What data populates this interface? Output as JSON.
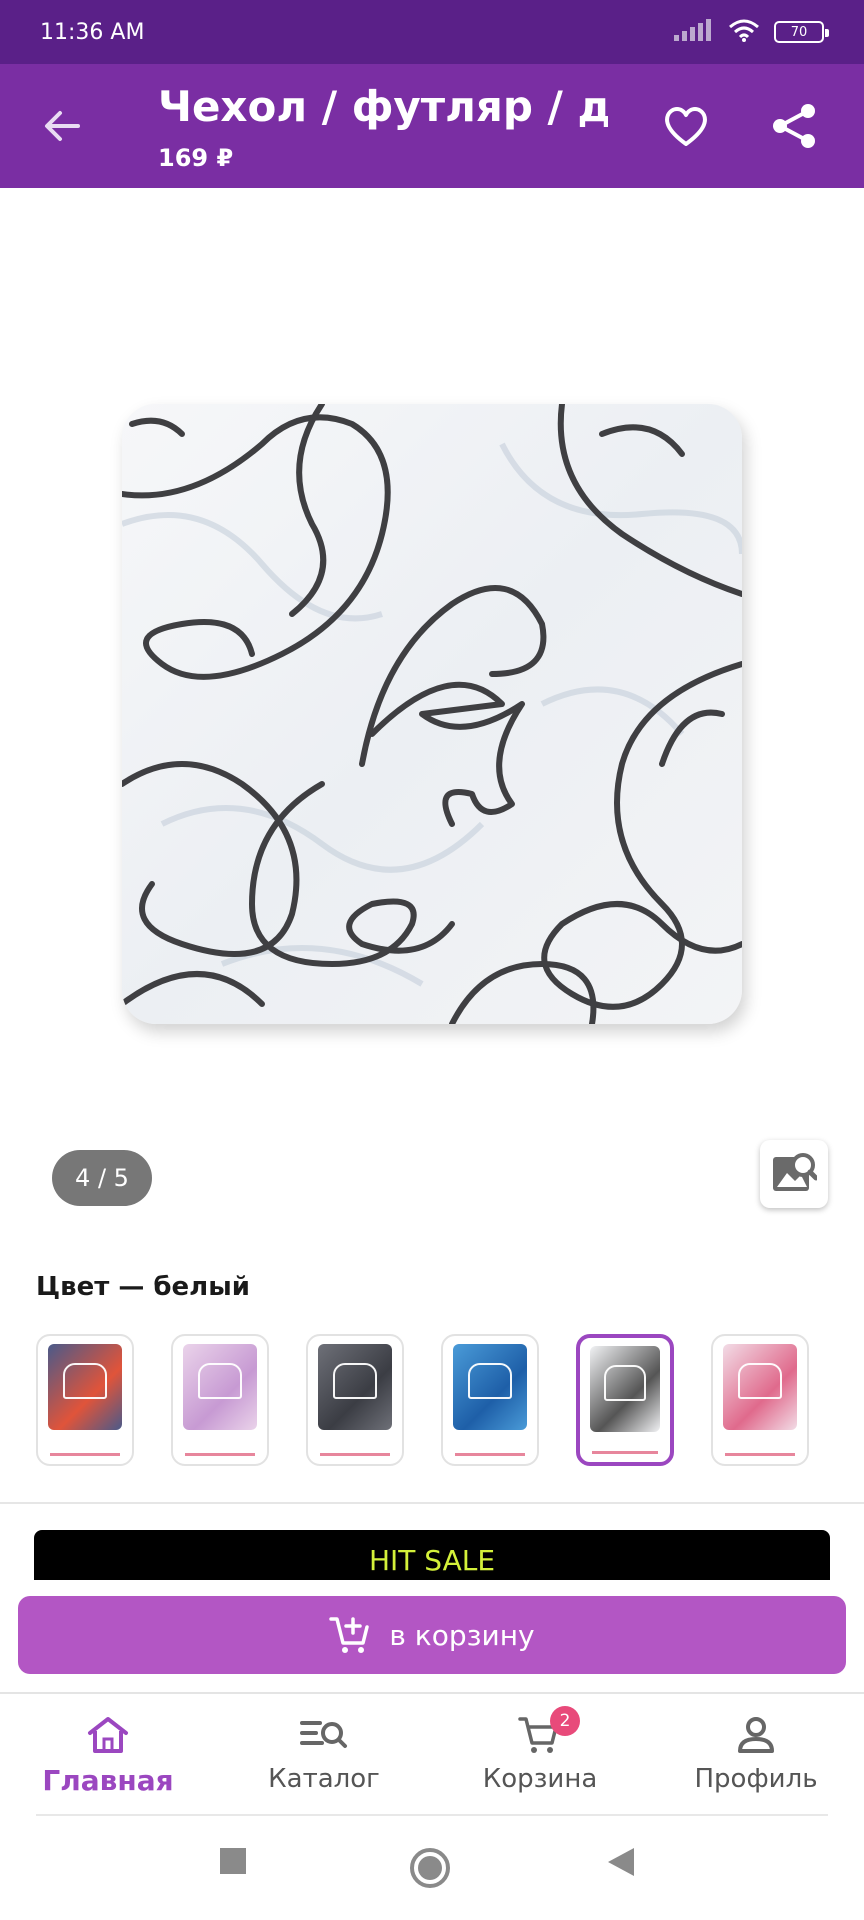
{
  "status_bar": {
    "time": "11:36 AM",
    "battery": "70"
  },
  "header": {
    "title": "Чехол / футляр / д...",
    "price": "169 ₽"
  },
  "gallery": {
    "counter": "4 / 5"
  },
  "color": {
    "label": "Цвет — белый"
  },
  "swatches": [
    {
      "name": "floral-dark",
      "color": "#4a5a8a",
      "accent": "#e0543a"
    },
    {
      "name": "pink-marble",
      "color": "#ead3ea",
      "accent": "#c79ad3"
    },
    {
      "name": "grey-marble",
      "color": "#6e7078",
      "accent": "#3b3d44"
    },
    {
      "name": "blue-ocean",
      "color": "#4a9bd8",
      "accent": "#1e5fa8"
    },
    {
      "name": "white-lines",
      "color": "#f1f2f4",
      "accent": "#555555"
    },
    {
      "name": "pink-flowers",
      "color": "#f2dce6",
      "accent": "#e06a8c"
    }
  ],
  "selected_swatch": 4,
  "banner": {
    "text": "HIT SALE"
  },
  "cart_button": {
    "label": "в корзину"
  },
  "bottom_nav": {
    "items": [
      {
        "label": "Главная",
        "icon": "home-icon",
        "active": true
      },
      {
        "label": "Каталог",
        "icon": "catalog-search-icon",
        "active": false
      },
      {
        "label": "Корзина",
        "icon": "cart-icon",
        "active": false,
        "badge": "2"
      },
      {
        "label": "Профиль",
        "icon": "profile-icon",
        "active": false
      }
    ]
  },
  "colors": {
    "app_bar": "#7a2ea3",
    "status_bar": "#5a2088",
    "accent": "#9b47c0",
    "button": "#b356c4",
    "badge": "#e84a7a"
  }
}
